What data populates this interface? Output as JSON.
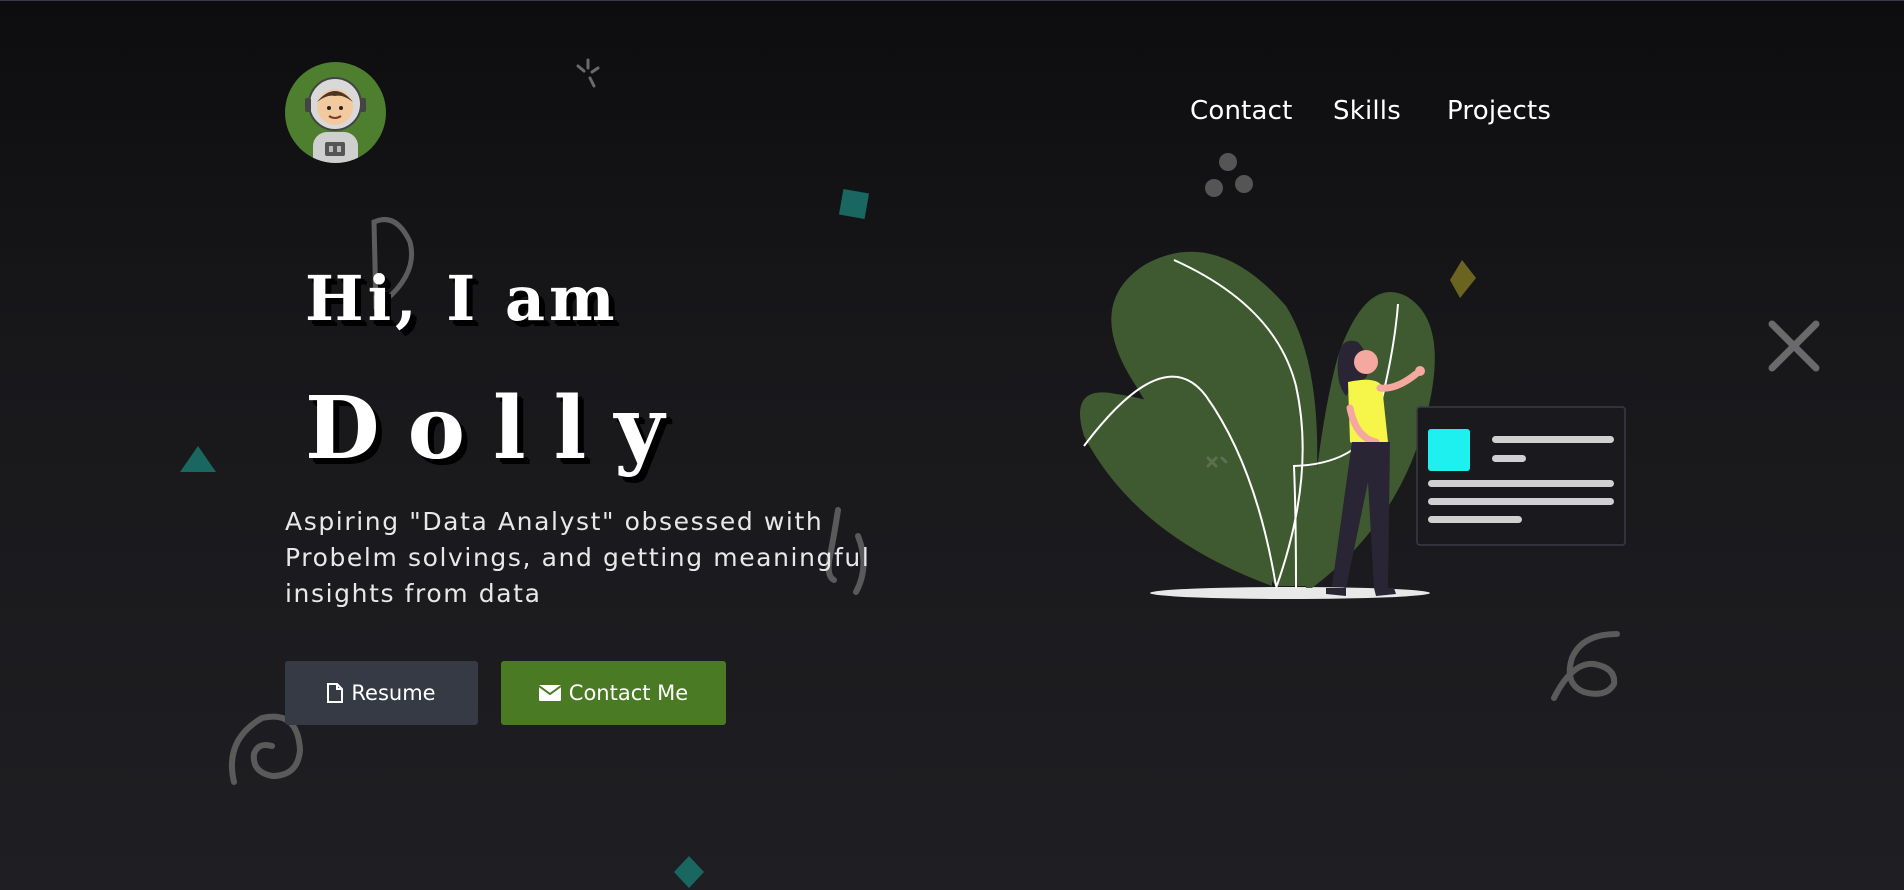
{
  "nav": {
    "items": [
      {
        "label": "Contact"
      },
      {
        "label": "Skills"
      },
      {
        "label": "Projects"
      }
    ]
  },
  "hero": {
    "greeting": "Hi, I am",
    "name": "Dolly",
    "tagline": "Aspiring \"Data Analyst\" obsessed with Probelm solvings, and getting meaningful insights from data"
  },
  "buttons": {
    "resume_label": "Resume",
    "contact_label": "Contact Me"
  },
  "colors": {
    "background": "#18181b",
    "accent_green": "#4a7a23",
    "button_dark": "#363a45",
    "leaf_green": "#3f5a30",
    "card_cyan": "#1ef0f0"
  },
  "icons": {
    "resume": "file-icon",
    "contact": "envelope-icon",
    "avatar": "astronaut-avatar"
  }
}
